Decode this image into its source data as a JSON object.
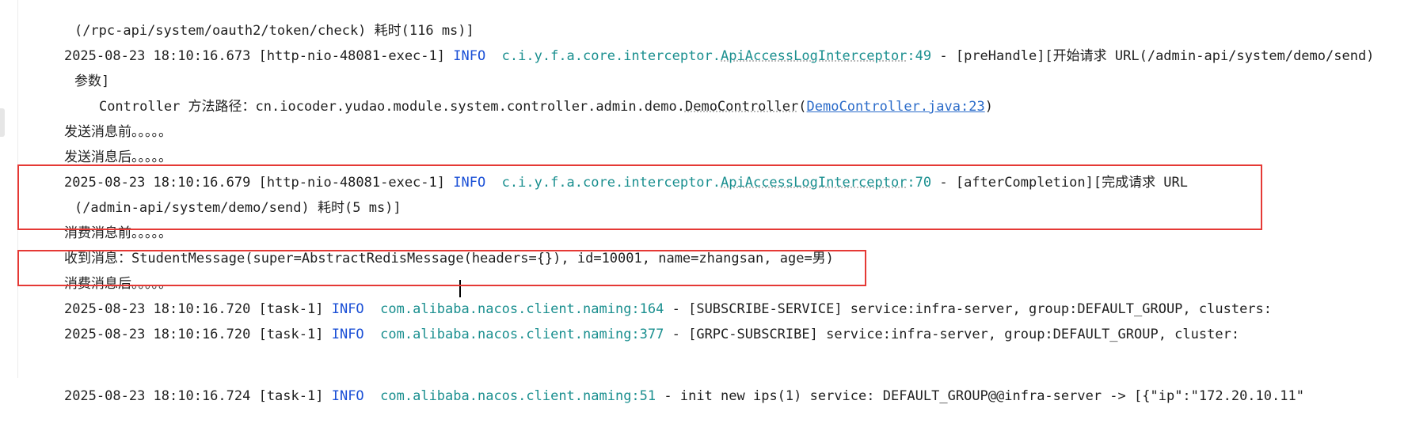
{
  "console": {
    "lines": [
      {
        "text": "(/rpc-api/system/oauth2/token/check) 耗时(116 ms)]"
      },
      {
        "ts": "2025-08-23 18:10:16.673 [http-nio-48081-exec-1] ",
        "level": "INFO",
        "logger_prefix": "c.i.y.f.a.core.interceptor.",
        "logger_class": "ApiAccessLogInterceptor",
        "logger_line": ":49",
        "msg": " - [preHandle][开始请求 URL(/admin-api/system/demo/send)"
      },
      {
        "text": "参数]"
      },
      {
        "prefix": "Controller 方法路径：cn.iocoder.yudao.module.system.controller.admin.demo.",
        "class": "DemoController",
        "paren_open": "(",
        "link": "DemoController.java:23",
        "paren_close": ")"
      },
      {
        "text": "发送消息前。。。。。"
      },
      {
        "text": "发送消息后。。。。。"
      },
      {
        "ts": "2025-08-23 18:10:16.679 [http-nio-48081-exec-1] ",
        "level": "INFO",
        "logger_prefix": "c.i.y.f.a.core.interceptor.",
        "logger_class": "ApiAccessLogInterceptor",
        "logger_line": ":70",
        "msg": " - [afterCompletion][完成请求 URL"
      },
      {
        "text": "(/admin-api/system/demo/send) 耗时(5 ms)]"
      },
      {
        "text": "消费消息前。。。。。"
      },
      {
        "text": "收到消息：StudentMessage(super=AbstractRedisMessage(headers={}), id=10001, name=zhangsan, age=男)"
      },
      {
        "text": "消费消息后。。。。。"
      },
      {
        "ts": "2025-08-23 18:10:16.720 [task-1] ",
        "level": "INFO",
        "logger": "com.alibaba.nacos.client.naming:164",
        "msg": " - [SUBSCRIBE-SERVICE] service:infra-server, group:DEFAULT_GROUP, clusters:"
      },
      {
        "ts": "2025-08-23 18:10:16.720 [task-1] ",
        "level": "INFO",
        "logger": "com.alibaba.nacos.client.naming:377",
        "msg": " - [GRPC-SUBSCRIBE] service:infra-server, group:DEFAULT_GROUP, cluster:"
      },
      {
        "ts": "2025-08-23 18:10:16.724 [task-1] ",
        "level": "INFO",
        "logger": "com.alibaba.nacos.client.naming:51",
        "msg": " - init new ips(1) service: DEFAULT_GROUP@@infra-server -> [{\"ip\":\"172.20.10.11\""
      }
    ]
  },
  "colors": {
    "info": "#1a4fd6",
    "logger": "#1a8f8f",
    "link": "#2a6bc9",
    "highlight_box": "#e53935"
  }
}
